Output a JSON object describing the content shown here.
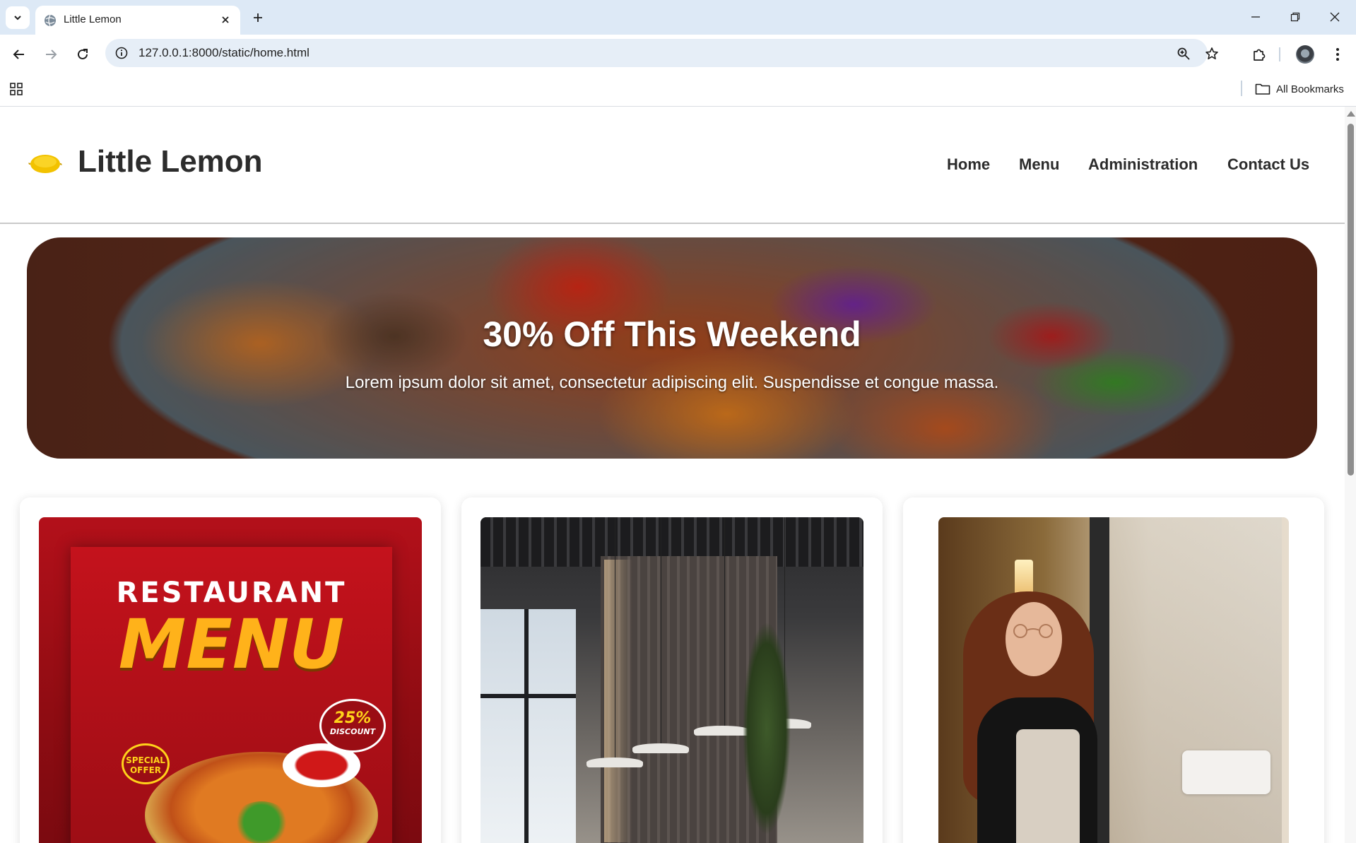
{
  "browser": {
    "tab_title": "Little Lemon",
    "url": "127.0.0.1:8000/static/home.html",
    "bookmarks_label": "All Bookmarks"
  },
  "site": {
    "logo_text": "Little Lemon",
    "nav": [
      "Home",
      "Menu",
      "Administration",
      "Contact Us"
    ]
  },
  "hero": {
    "title": "30% Off This Weekend",
    "subtitle": "Lorem ipsum dolor sit amet, consectetur adipiscing elit. Suspendisse et congue massa."
  },
  "cards": {
    "menu_poster": {
      "line1": "RESTAURANT",
      "line2": "MENU",
      "discount_value": "25%",
      "discount_label": "DISCOUNT",
      "special_line1": "SPECIAL",
      "special_line2": "OFFER"
    }
  },
  "colors": {
    "tab_strip": "#dde9f6",
    "omnibox": "#e6eef7",
    "heading_text": "#2c2c2c",
    "logo_lemon": "#f2c200"
  }
}
